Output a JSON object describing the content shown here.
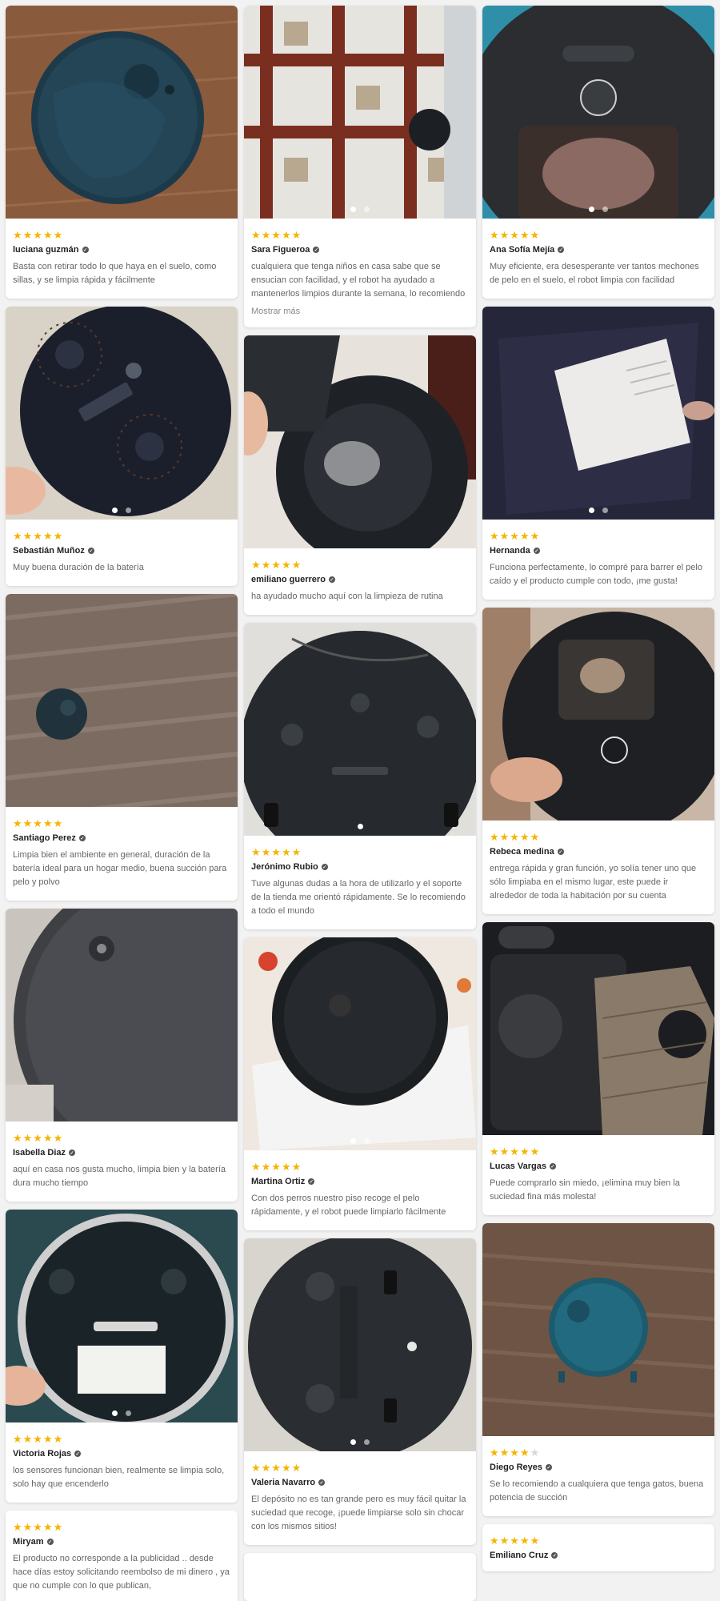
{
  "columns": [
    [
      {
        "name": "luciana guzmán",
        "stars": 5,
        "text": "Basta con retirar todo lo que haya en el suelo, como sillas, y se limpia rápida y fácilmente",
        "photo": "robot-top-blue-floor",
        "dots": 0
      },
      {
        "name": "Sebastián Muñoz",
        "stars": 5,
        "text": "Muy buena duración de la batería",
        "photo": "robot-bottom-brushes",
        "dots": 2
      },
      {
        "name": "Santiago Perez",
        "stars": 5,
        "text": "Limpia bien el ambiente en general, duración de la batería ideal para un hogar medio, buena succión para pelo y polvo",
        "photo": "robot-on-wood-floor",
        "dots": 0
      },
      {
        "name": "Isabella Diaz",
        "stars": 5,
        "text": "aquí en casa nos gusta mucho, limpia bien y la batería dura mucho tiempo",
        "photo": "robot-grey-closeup",
        "dots": 0
      },
      {
        "name": "Victoria Rojas",
        "stars": 5,
        "text": "los sensores funcionan bien, realmente se limpia solo, solo hay que encenderlo",
        "photo": "robot-bottom-mop",
        "dots": 2
      },
      {
        "name": "Miryam",
        "stars": 5,
        "text": "El producto no corresponde a la publicidad .. desde hace días estoy solicitando reembolso de mi dinero , ya que no cumple con lo que publican,",
        "photo": "",
        "dots": 0
      }
    ],
    [
      {
        "name": "Sara Figueroa",
        "stars": 5,
        "text": "cualquiera que tenga niños en casa sabe que se ensucian con facilidad, y el robot ha ayudado a mantenerlos limpios durante la semana, lo recomiendo",
        "more": "Mostrar más",
        "photo": "robot-on-tiles",
        "dots": 2
      },
      {
        "name": "emiliano guerrero",
        "stars": 5,
        "text": "ha ayudado mucho aquí con la limpieza de rutina",
        "photo": "robot-dustbin-open",
        "dots": 0
      },
      {
        "name": "Jerónimo Rubio",
        "stars": 5,
        "text": "Tuve algunas dudas a la hora de utilizarlo y el soporte de la tienda me orientó rápidamente. Se lo recomiendo a todo el mundo",
        "photo": "robot-bottom-wheels",
        "dots": 1
      },
      {
        "name": "Martina Ortiz",
        "stars": 5,
        "text": "Con dos perros nuestro piso recoge el pelo rápidamente, y el robot puede limpiarlo fácilmente",
        "photo": "robot-on-box",
        "dots": 2
      },
      {
        "name": "Valeria Navarro",
        "stars": 5,
        "text": "El depósito no es tan grande pero es muy fácil quitar la suciedad que recoge, ¡puede limpiarse solo sin chocar con los mismos sitios!",
        "photo": "robot-bottom-round",
        "dots": 2
      },
      {
        "name": "",
        "stars": 0,
        "text": "",
        "photo": "",
        "dots": 0
      }
    ],
    [
      {
        "name": "Ana Sofía Mejía",
        "stars": 5,
        "text": "Muy eficiente, era desesperante ver tantos mechones de pelo en el suelo, el robot limpia con facilidad",
        "photo": "robot-bin-hair",
        "dots": 2
      },
      {
        "name": "Hernanda",
        "stars": 5,
        "text": "Funciona perfectamente, lo compré para barrer el pelo caído y el producto cumple con todo, ¡me gusta!",
        "photo": "package-bag",
        "dots": 2
      },
      {
        "name": "Rebeca medina",
        "stars": 5,
        "text": "entrega rápida y gran función, yo solía tener uno que sólo limpiaba en el mismo lugar, este puede ir alrededor de toda la habitación por su cuenta",
        "photo": "robot-hand-filter",
        "dots": 0
      },
      {
        "name": "Lucas Vargas",
        "stars": 5,
        "text": "Puede comprarlo sin miedo, ¡elimina muy bien la suciedad fina más molesta!",
        "photo": "robot-filter-dirty",
        "dots": 0
      },
      {
        "name": "Diego Reyes",
        "stars": 4,
        "text": "Se lo recomiendo a cualquiera que tenga gatos, buena potencia de succión",
        "photo": "robot-teal-floor",
        "dots": 0
      },
      {
        "name": "Emiliano Cruz",
        "stars": 5,
        "text": "",
        "photo": "",
        "dots": 0
      }
    ]
  ],
  "colors": {
    "star": "#f5b400",
    "star_off": "#d6d6d6",
    "name": "#222222",
    "text": "#666666",
    "background": "#f2f2f2"
  },
  "icons": {
    "verified": "check-circle-icon",
    "star": "star-icon"
  }
}
